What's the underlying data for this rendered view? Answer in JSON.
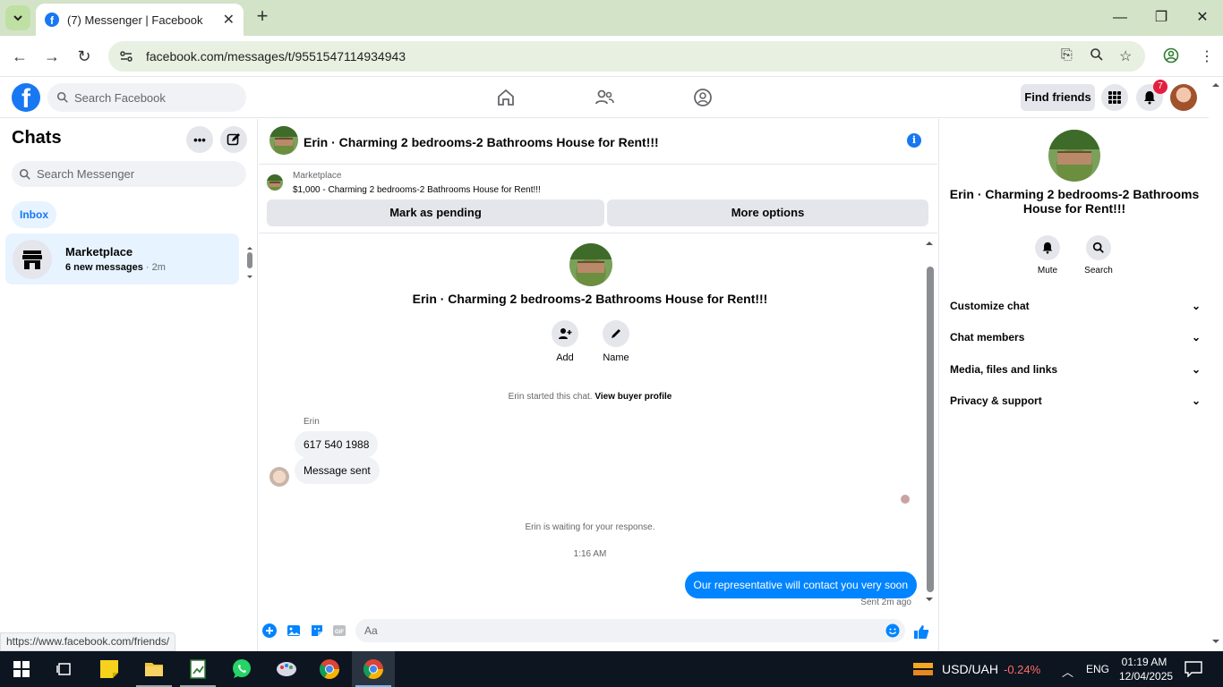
{
  "browser": {
    "tab_title": "(7) Messenger | Facebook",
    "url": "facebook.com/messages/t/9551547114934943",
    "status_url": "https://www.facebook.com/friends/"
  },
  "fb_header": {
    "search_placeholder": "Search Facebook",
    "find_friends": "Find friends",
    "notification_count": "7"
  },
  "sidebar": {
    "title": "Chats",
    "search_placeholder": "Search Messenger",
    "filter": "Inbox",
    "chats": [
      {
        "name": "Marketplace",
        "preview": "6 new messages",
        "time": "· 2m"
      }
    ]
  },
  "conversation": {
    "header_title": "Erin · Charming 2 bedrooms-2 Bathrooms House for Rent!!!",
    "marketplace_label": "Marketplace",
    "listing": "$1,000 - Charming 2 bedrooms-2 Bathrooms House for Rent!!!",
    "mark_pending": "Mark as pending",
    "more_options": "More options",
    "profile_name": "Erin · Charming 2 bedrooms-2 Bathrooms House for Rent!!!",
    "add_label": "Add",
    "name_label": "Name",
    "started_text": "Erin started this chat.",
    "view_buyer": "View buyer profile",
    "sender_name": "Erin",
    "messages_in": [
      "617 540 1988",
      "Message sent"
    ],
    "waiting_text": "Erin is waiting for your response.",
    "time": "1:16 AM",
    "message_out": "Our representative will contact you very soon",
    "sent_status": "Sent 2m ago",
    "input_placeholder": "Aa"
  },
  "details": {
    "name": "Erin · Charming 2 bedrooms-2 Bathrooms House for Rent!!!",
    "mute": "Mute",
    "search": "Search",
    "sections": [
      "Customize chat",
      "Chat members",
      "Media, files and links",
      "Privacy & support"
    ]
  },
  "taskbar": {
    "currency": "USD/UAH",
    "change": "-0.24%",
    "lang": "ENG",
    "time": "01:19 AM",
    "date": "12/04/2025"
  },
  "colors": {
    "fb_blue": "#1877f2",
    "bubble_out": "#0084ff",
    "tab_strip": "#d3e3c7"
  }
}
